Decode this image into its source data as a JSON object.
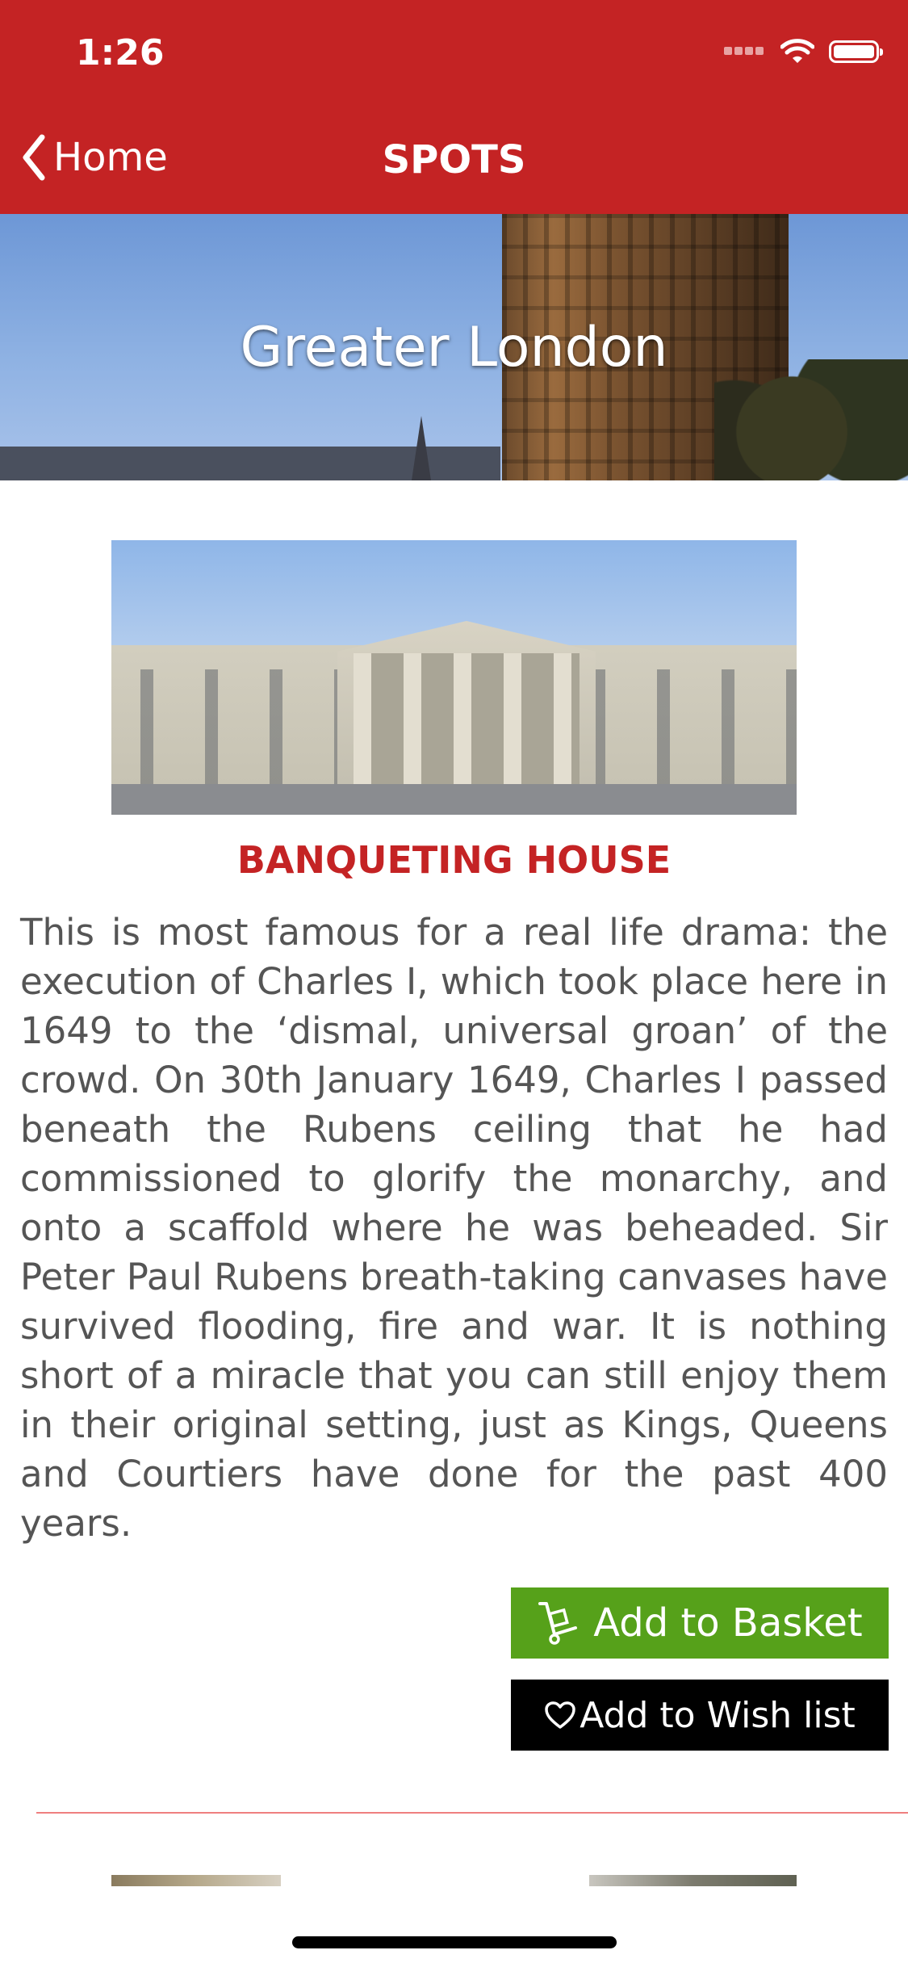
{
  "status_bar": {
    "time": "1:26"
  },
  "nav": {
    "back_label": "Home",
    "title": "SPOTS"
  },
  "hero": {
    "title": "Greater London"
  },
  "spot": {
    "title": "BANQUETING HOUSE",
    "description": "This is most famous for a real life drama: the execution of Charles I, which took place here in 1649 to the ‘dismal, universal groan’ of the crowd. On 30th January 1649, Charles I passed beneath the Rubens ceiling that he had commissioned to glorify the monarchy, and onto a scaffold where he was beheaded. Sir Peter Paul Rubens breath-taking canvases have survived flooding, fire and war. It is nothing short of a miracle that you can still enjoy them in their original setting, just as Kings, Queens and Courtiers have done for the past 400 years."
  },
  "actions": {
    "add_to_basket": "Add to Basket",
    "add_to_wishlist": "Add to Wish list"
  },
  "colors": {
    "brand_red": "#c42324",
    "basket_green": "#56a11a",
    "wish_black": "#000000",
    "divider_pink": "#ef7f7f"
  },
  "icons": {
    "back": "chevron-left-icon",
    "wifi": "wifi-icon",
    "battery": "battery-icon",
    "basket": "hand-truck-icon",
    "wishlist": "heart-outline-icon"
  }
}
